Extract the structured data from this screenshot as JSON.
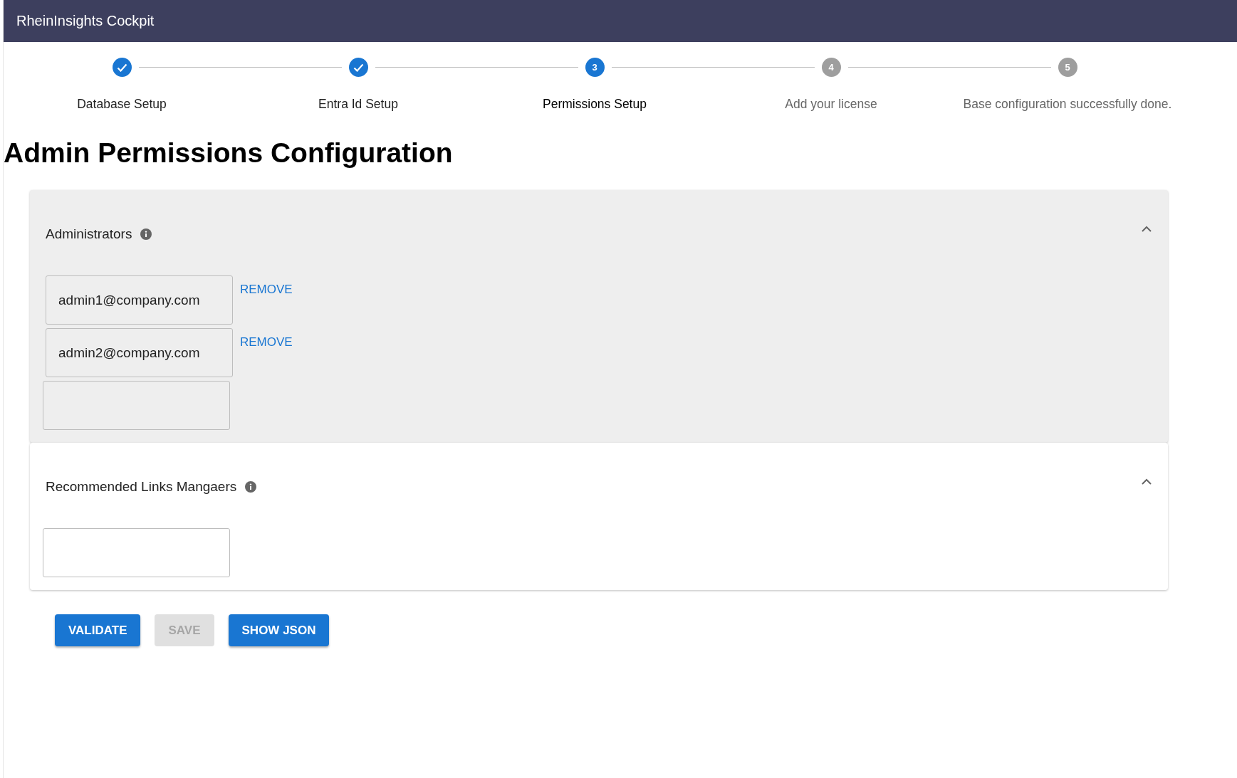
{
  "header": {
    "title": "RheinInsights Cockpit"
  },
  "steps": [
    {
      "label": "Database Setup",
      "completed": true,
      "active": false
    },
    {
      "label": "Entra Id Setup",
      "completed": true,
      "active": false
    },
    {
      "label": "Permissions Setup",
      "number": "3",
      "completed": false,
      "active": true
    },
    {
      "label": "Add your license",
      "number": "4",
      "completed": false,
      "active": false
    },
    {
      "label": "Base configuration successfully done.",
      "number": "5",
      "completed": false,
      "active": false
    }
  ],
  "page_title": "Admin Permissions Configuration",
  "sections": [
    {
      "title": "Administrators",
      "expanded": true,
      "highlighted": true,
      "fields": [
        {
          "kind": "entry",
          "value": "admin1@company.com",
          "remove_label": "REMOVE"
        },
        {
          "kind": "entry",
          "value": "admin2@company.com",
          "remove_label": "REMOVE"
        },
        {
          "kind": "empty"
        }
      ]
    },
    {
      "title": "Recommended Links Mangaers",
      "expanded": true,
      "highlighted": false,
      "fields": [
        {
          "kind": "empty"
        }
      ]
    }
  ],
  "buttons": [
    {
      "label": "VALIDATE",
      "disabled": false
    },
    {
      "label": "SAVE",
      "disabled": true
    },
    {
      "label": "SHOW JSON",
      "disabled": false
    }
  ]
}
